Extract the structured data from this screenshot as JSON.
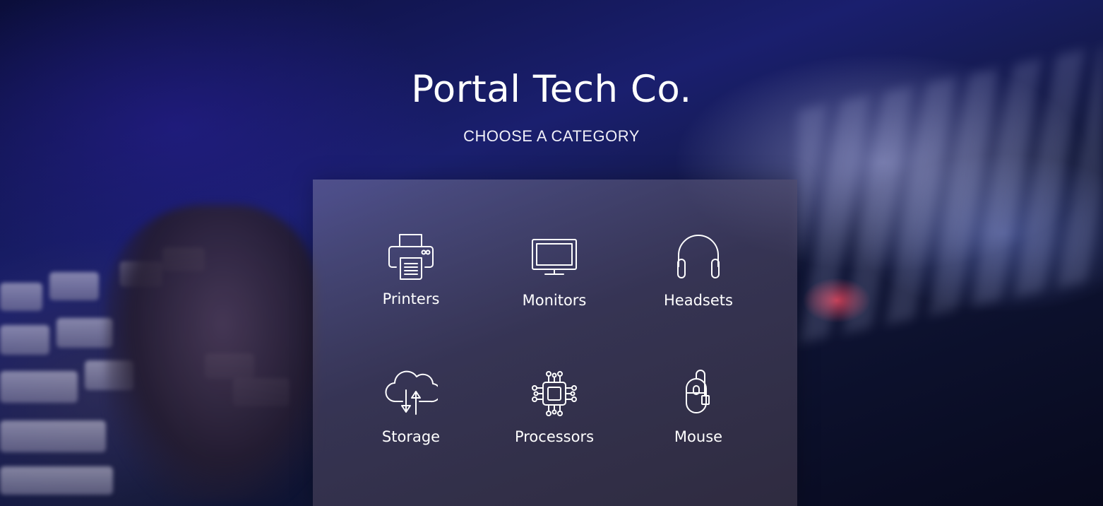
{
  "header": {
    "title": "Portal Tech Co.",
    "subtitle": "CHOOSE A CATEGORY"
  },
  "categories": [
    {
      "label": "Printers",
      "icon": "printer-icon"
    },
    {
      "label": "Monitors",
      "icon": "monitor-icon"
    },
    {
      "label": "Headsets",
      "icon": "headset-icon"
    },
    {
      "label": "Storage",
      "icon": "cloud-storage-icon"
    },
    {
      "label": "Processors",
      "icon": "processor-chip-icon"
    },
    {
      "label": "Mouse",
      "icon": "mouse-icon"
    }
  ],
  "colors": {
    "background": "#141a55",
    "panel": "#5a5575",
    "text": "#ffffff"
  }
}
